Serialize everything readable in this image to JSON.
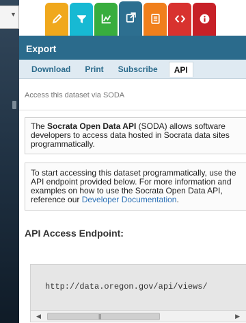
{
  "tab_icons": [
    {
      "name": "pencil-icon",
      "color": "#f0a81c"
    },
    {
      "name": "filter-icon",
      "color": "#17b9d3"
    },
    {
      "name": "chart-icon",
      "color": "#38ad3e"
    },
    {
      "name": "share-icon",
      "color": "#2d6f90"
    },
    {
      "name": "document-icon",
      "color": "#f07f1c"
    },
    {
      "name": "code-icon",
      "color": "#d8322f"
    },
    {
      "name": "info-icon",
      "color": "#c72027"
    }
  ],
  "panel": {
    "title": "Export",
    "subtabs": [
      "Download",
      "Print",
      "Subscribe",
      "API"
    ],
    "active_subtab": "API",
    "intro": "Access this dataset via SODA",
    "soda_box": {
      "pre": "The ",
      "bold": "Socrata Open Data API",
      "post": " (SODA) allows software developers to access data hosted in Socrata data sites programmatically."
    },
    "start_box": {
      "text": "To start accessing this dataset programmatically, use the API endpoint provided below. For more information and examples on how to use the Socrata Open Data API, reference our ",
      "link": "Developer Documentation",
      "tail": "."
    },
    "endpoint_title": "API Access Endpoint:",
    "endpoint_url": "http://data.oregon.gov/api/views/"
  },
  "colors": {
    "header": "#2b6b8c",
    "subtab_bar": "#dfeaf2",
    "link": "#2a6fb5"
  }
}
